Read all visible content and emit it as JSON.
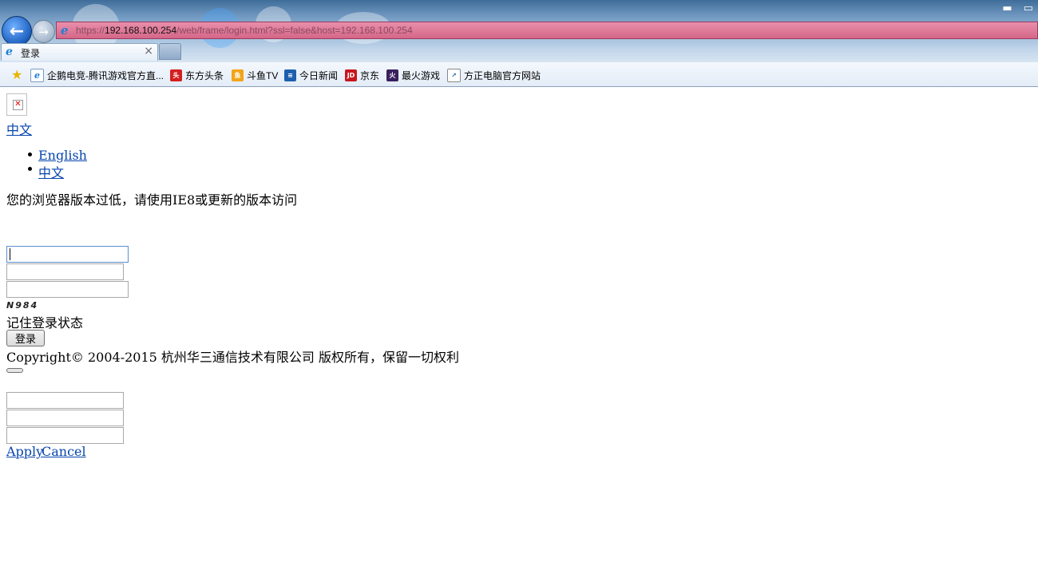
{
  "browser": {
    "url_prefix": "https://",
    "url_host": "192.168.100.254",
    "url_rest": "/web/frame/login.html?ssl=false&host=192.168.100.254",
    "tab_label": "登录",
    "tab_close": "×",
    "favorites": [
      {
        "label": "企鹅电竞-腾讯游戏官方直...",
        "icon": "ie-page-icon"
      },
      {
        "label": "东方头条",
        "icon": "toutiao-icon"
      },
      {
        "label": "斗鱼TV",
        "icon": "douyu-icon"
      },
      {
        "label": "今日新闻",
        "icon": "news-icon"
      },
      {
        "label": "京东",
        "icon": "jd-icon"
      },
      {
        "label": "最火游戏",
        "icon": "game-icon"
      },
      {
        "label": "方正电脑官方网站",
        "icon": "shortcut-icon"
      }
    ]
  },
  "page": {
    "lang_current": "中文",
    "lang_options": [
      "English",
      "中文"
    ],
    "browser_warning": "您的浏览器版本过低，请使用IE8或更新的版本访问",
    "captcha_text": "N984",
    "remember_label": "记住登录状态",
    "login_button": "登录",
    "copyright": "Copyright© 2004-2015 杭州华三通信技术有限公司 版权所有，保留一切权利",
    "apply_link": "Apply",
    "cancel_link": "Cancel"
  }
}
